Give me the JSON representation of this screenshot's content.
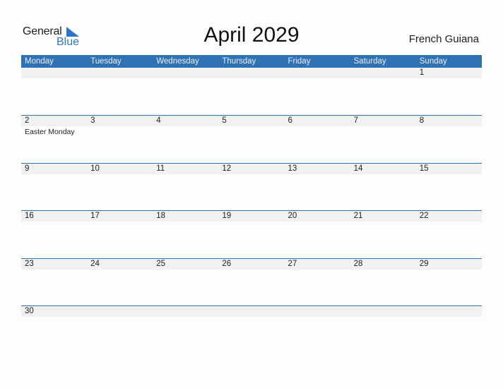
{
  "logo": {
    "text_general": "General",
    "text_blue": "Blue",
    "accent": "#2e75c9"
  },
  "title": "April 2029",
  "region": "French Guiana",
  "colors": {
    "header_bg": "#2f72b4",
    "day_strip_bg": "#f1f1f1"
  },
  "weekdays": [
    "Monday",
    "Tuesday",
    "Wednesday",
    "Thursday",
    "Friday",
    "Saturday",
    "Sunday"
  ],
  "weeks": [
    {
      "days": [
        "",
        "",
        "",
        "",
        "",
        "",
        "1"
      ],
      "events": [
        "",
        "",
        "",
        "",
        "",
        "",
        ""
      ]
    },
    {
      "days": [
        "2",
        "3",
        "4",
        "5",
        "6",
        "7",
        "8"
      ],
      "events": [
        "Easter Monday",
        "",
        "",
        "",
        "",
        "",
        ""
      ]
    },
    {
      "days": [
        "9",
        "10",
        "11",
        "12",
        "13",
        "14",
        "15"
      ],
      "events": [
        "",
        "",
        "",
        "",
        "",
        "",
        ""
      ]
    },
    {
      "days": [
        "16",
        "17",
        "18",
        "19",
        "20",
        "21",
        "22"
      ],
      "events": [
        "",
        "",
        "",
        "",
        "",
        "",
        ""
      ]
    },
    {
      "days": [
        "23",
        "24",
        "25",
        "26",
        "27",
        "28",
        "29"
      ],
      "events": [
        "",
        "",
        "",
        "",
        "",
        "",
        ""
      ]
    },
    {
      "days": [
        "30",
        "",
        "",
        "",
        "",
        "",
        ""
      ],
      "events": [
        "",
        "",
        "",
        "",
        "",
        "",
        ""
      ]
    }
  ]
}
